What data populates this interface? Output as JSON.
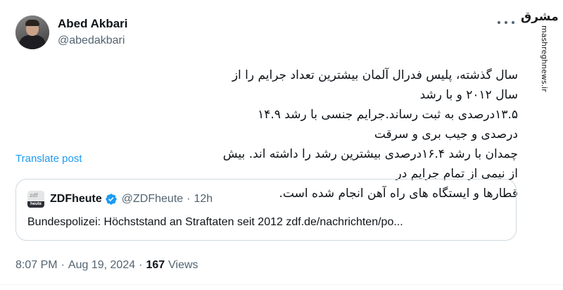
{
  "author": {
    "display_name": "Abed Akbari",
    "handle": "@abedakbari"
  },
  "watermark": {
    "logo_text": "مشرق",
    "url": "mashreghnews.ir"
  },
  "tweet": {
    "text_lines": [
      "سال گذشته، پلیس فدرال آلمان بیشترین تعداد جرایم را از سال ۲۰۱۲ و با رشد",
      "۱۳.۵درصدی به ثبت رساند.جرایم جنسی با رشد ۱۴.۹ درصدی و جیب بری و سرقت",
      "چمدان با رشد ۱۶.۴درصدی بیشترین رشد را داشته اند. بیش از نیمی از تمام جرایم در",
      "قطارها و ایستگاه های راه آهن انجام شده است."
    ],
    "translate_label": "Translate post"
  },
  "quote": {
    "logo_top": "zdf",
    "logo_bottom": "heute",
    "name": "ZDFheute",
    "handle": "@ZDFheute",
    "separator": "·",
    "time": "12h",
    "text": "Bundespolizei: Höchststand an Straftaten seit 2012 zdf.de/nachrichten/po..."
  },
  "meta": {
    "time": "8:07 PM",
    "date": "Aug 19, 2024",
    "views_count": "167",
    "views_label": "Views",
    "separator": "·"
  },
  "colors": {
    "accent": "#1d9bf0",
    "muted": "#536471",
    "text": "#0f1419",
    "border": "#cfd9de"
  }
}
